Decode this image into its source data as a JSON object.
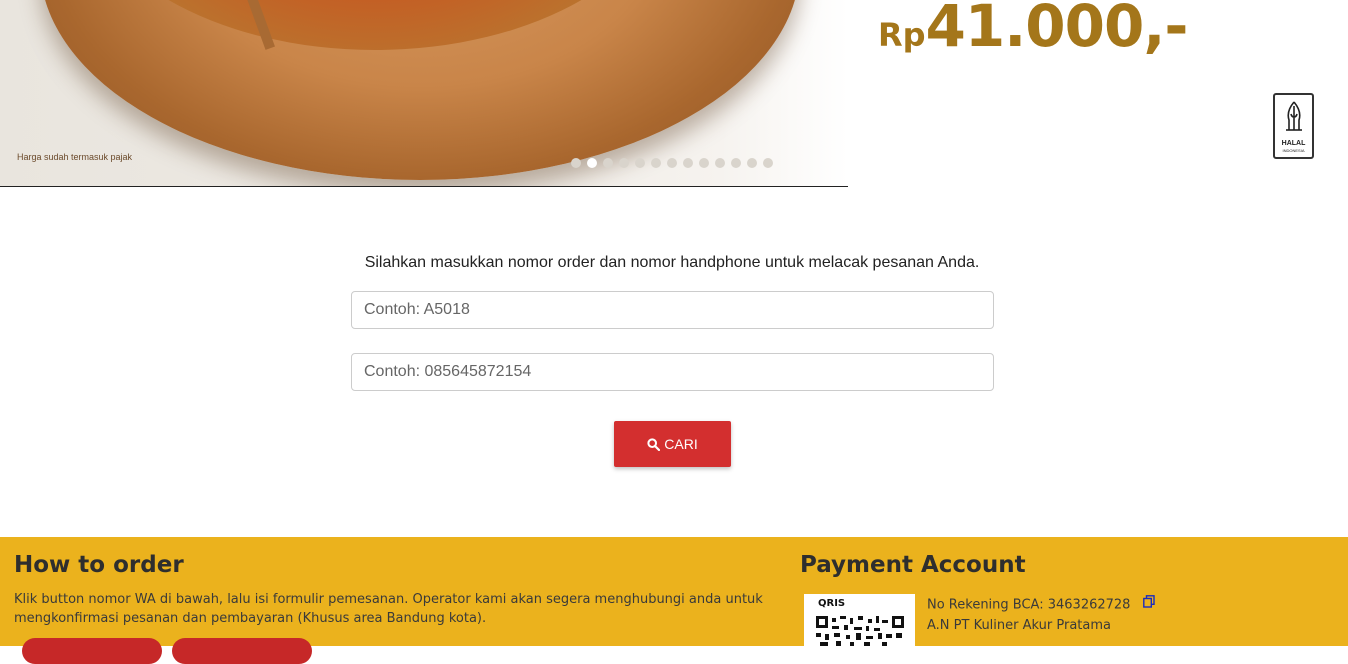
{
  "banner": {
    "tax_note": "Harga sudah termasuk pajak",
    "price_prefix": "Rp",
    "price_amount": "41.000,-",
    "carousel_total": 13,
    "carousel_active": 2,
    "halal_label": "HALAL",
    "halal_sub": "INDONESIA",
    "price_color": "#a4761a"
  },
  "tracking": {
    "instruction": "Silahkan masukkan nomor order dan nomor handphone untuk melacak pesanan Anda.",
    "order_placeholder": "Contoh: A5018",
    "phone_placeholder": "Contoh: 085645872154",
    "search_label": "CARI",
    "button_color": "#d32f2f"
  },
  "footer": {
    "how_title": "How to order",
    "how_text": "Klik button nomor WA di bawah, lalu isi formulir pemesanan. Operator kami akan segera menghubungi anda untuk mengkonfirmasi pesanan dan pembayaran (Khusus area Bandung kota).",
    "payment_title": "Payment Account",
    "qris_logo": "QRIS",
    "account_number_line": "No Rekening BCA: 3463262728",
    "account_name_line": "A.N PT Kuliner Akur Pratama",
    "background_color": "#ebb21d"
  }
}
